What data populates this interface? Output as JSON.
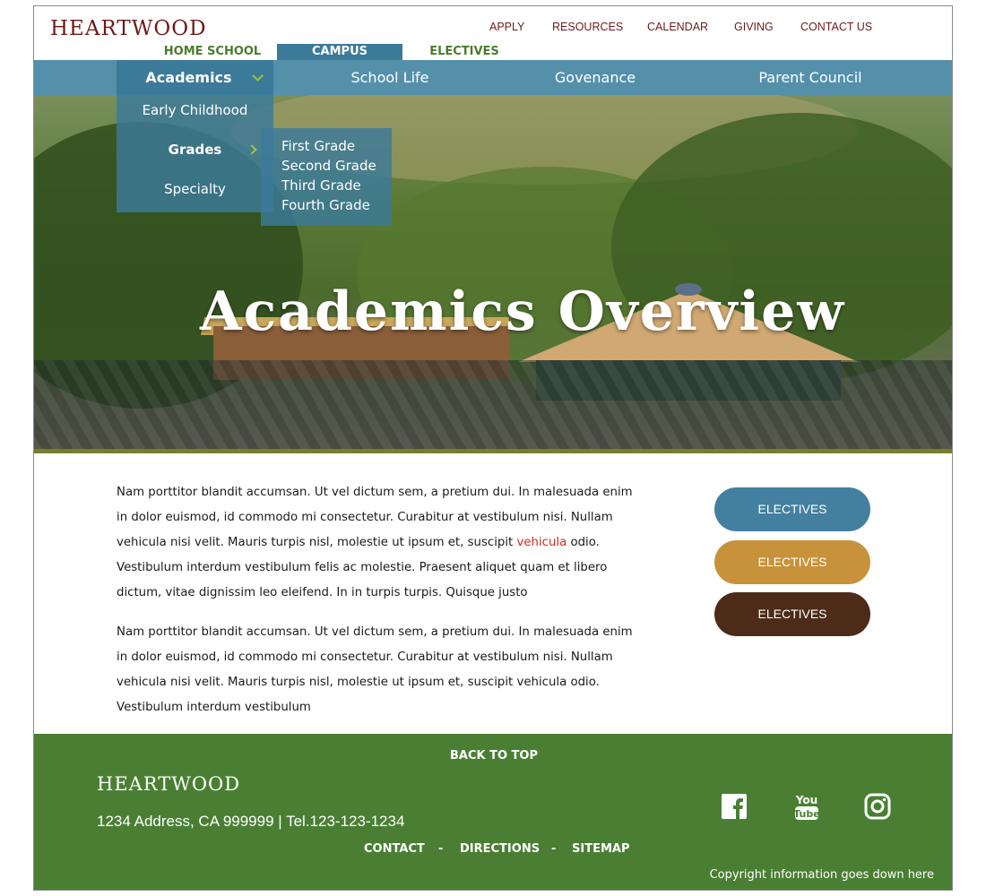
{
  "header": {
    "logo": "HEARTWOOD",
    "utility": [
      "APPLY",
      "RESOURCES",
      "CALENDAR",
      "GIVING",
      "CONTACT US"
    ],
    "site_tabs": [
      "HOME SCHOOL",
      "CAMPUS",
      "ELECTIVES"
    ]
  },
  "nav": {
    "items": [
      "Academics",
      "School Life",
      "Govenance",
      "Parent Council"
    ]
  },
  "dropdown": {
    "items": [
      "Early Childhood",
      "Grades",
      "Specialty"
    ],
    "grades_sub": [
      "First Grade",
      "Second Grade",
      "Third Grade",
      "Fourth Grade"
    ]
  },
  "hero": {
    "title": "Academics Overview"
  },
  "content": {
    "p1_before": "Nam porttitor blandit accumsan. Ut vel dictum sem, a pretium dui. In malesuada enim in dolor euismod, id commodo mi consectetur. Curabitur at vestibulum nisi. Nullam vehicula nisi velit. Mauris turpis nisl, molestie ut ipsum et, suscipit ",
    "p1_link": "vehicula",
    "p1_after": " odio. Vestibulum interdum vestibulum felis ac molestie. Praesent aliquet quam et libero dictum, vitae dignissim leo eleifend. In in turpis turpis. Quisque justo",
    "p2": "Nam porttitor blandit accumsan. Ut vel dictum sem, a pretium dui. In malesuada enim in dolor euismod, id commodo mi consectetur. Curabitur at vestibulum nisi. Nullam vehicula nisi velit. Mauris turpis nisl, molestie ut ipsum et, suscipit vehicula odio. Vestibulum interdum vestibulum"
  },
  "side_buttons": [
    {
      "label": "ELECTIVES",
      "color": "#43809f"
    },
    {
      "label": "ELECTIVES",
      "color": "#c8923a"
    },
    {
      "label": "ELECTIVES",
      "color": "#4c2c18"
    }
  ],
  "footer": {
    "back_to_top": "BACK TO TOP",
    "logo": "HEARTWOOD",
    "address": "1234 Address, CA 999999 |  Tel.123-123-1234",
    "links": [
      "CONTACT",
      "DIRECTIONS",
      "SITEMAP"
    ],
    "separator": "-",
    "copyright": "Copyright information goes down here",
    "social_icons": [
      "facebook-icon",
      "youtube-icon",
      "instagram-icon"
    ]
  },
  "colors": {
    "brand_red": "#6e1a1a",
    "nav_blue": "#5590ab",
    "nav_active": "#3c7a9a",
    "accent_green": "#9bc53d",
    "footer_green": "#4a7f33",
    "tab_green": "#4a7c2e",
    "link_red": "#cc2a1e"
  }
}
